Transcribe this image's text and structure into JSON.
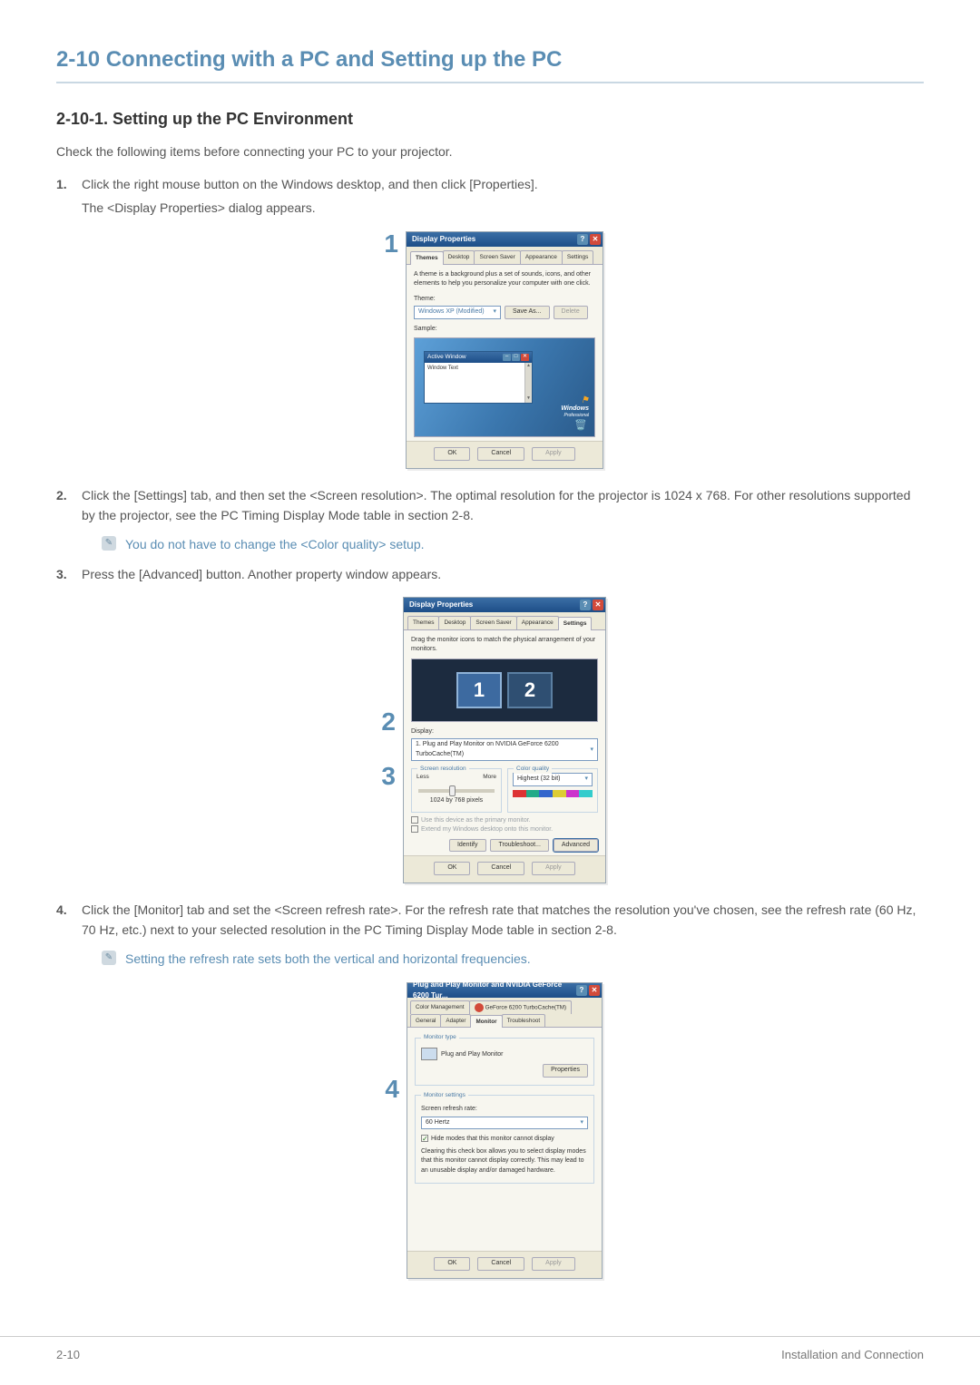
{
  "heading": "2-10  Connecting with a PC and Setting up the PC",
  "subheading": "2-10-1. Setting up the PC Environment",
  "intro": "Check the following items before connecting your PC to your projector.",
  "steps": {
    "s1num": "1.",
    "s1a": "Click the right mouse button on the Windows desktop, and then click [Properties].",
    "s1b": "The <Display Properties> dialog appears.",
    "s2num": "2.",
    "s2": "Click the [Settings] tab, and then set the <Screen resolution>. The optimal resolution for the projector is 1024 x 768. For other resolutions supported by the projector, see the PC Timing Display Mode table in section 2-8.",
    "s2note": "You do not have to change the <Color quality> setup.",
    "s3num": "3.",
    "s3": "Press the [Advanced] button. Another property window appears.",
    "s4num": "4.",
    "s4": "Click the [Monitor] tab and set the <Screen refresh rate>. For the refresh rate that matches the resolution you've chosen, see the refresh rate (60 Hz, 70 Hz, etc.) next to your selected resolution in the PC Timing Display Mode table in section 2-8.",
    "s4note": "Setting the refresh rate sets both the vertical and horizontal frequencies."
  },
  "callouts": {
    "c1": "1",
    "c2": "2",
    "c3": "3",
    "c4": "4"
  },
  "dlg1": {
    "title": "Display Properties",
    "tabs": {
      "themes": "Themes",
      "desktop": "Desktop",
      "saver": "Screen Saver",
      "appearance": "Appearance",
      "settings": "Settings"
    },
    "desc": "A theme is a background plus a set of sounds, icons, and other elements to help you personalize your computer with one click.",
    "theme_label": "Theme:",
    "theme_value": "Windows XP (Modified)",
    "save_as": "Save As...",
    "delete": "Delete",
    "sample": "Sample:",
    "active_window": "Active Window",
    "window_text": "Window Text",
    "logo": "Windows",
    "logo_sub": "Professional",
    "ok": "OK",
    "cancel": "Cancel",
    "apply": "Apply"
  },
  "dlg2": {
    "title": "Display Properties",
    "tabs": {
      "themes": "Themes",
      "desktop": "Desktop",
      "saver": "Screen Saver",
      "appearance": "Appearance",
      "settings": "Settings"
    },
    "drag": "Drag the monitor icons to match the physical arrangement of your monitors.",
    "m1": "1",
    "m2": "2",
    "display_label": "Display:",
    "display_value": "1. Plug and Play Monitor on NVIDIA GeForce 6200 TurboCache(TM)",
    "res_group": "Screen resolution",
    "less": "Less",
    "more": "More",
    "res_value": "1024 by 768  pixels",
    "cq_group": "Color quality",
    "cq_value": "Highest (32 bit)",
    "primary": "Use this device as the primary monitor.",
    "extend": "Extend my Windows desktop onto this monitor.",
    "identify": "Identify",
    "troubleshoot": "Troubleshoot...",
    "advanced": "Advanced",
    "ok": "OK",
    "cancel": "Cancel",
    "apply": "Apply"
  },
  "dlg3": {
    "title": "Plug and Play Monitor and NVIDIA GeForce 6200 Tur...",
    "tabs": {
      "cm": "Color Management",
      "gf": "GeForce 6200 TurboCache(TM)",
      "gen": "General",
      "adp": "Adapter",
      "mon": "Monitor",
      "trb": "Troubleshoot"
    },
    "mt_group": "Monitor type",
    "mt_value": "Plug and Play Monitor",
    "properties": "Properties",
    "ms_group": "Monitor settings",
    "rr_label": "Screen refresh rate:",
    "rr_value": "60 Hertz",
    "hide": "Hide modes that this monitor cannot display",
    "hide_desc": "Clearing this check box allows you to select display modes that this monitor cannot display correctly. This may lead to an unusable display and/or damaged hardware.",
    "ok": "OK",
    "cancel": "Cancel",
    "apply": "Apply"
  },
  "footer": {
    "left": "2-10",
    "right": "Installation and Connection"
  }
}
